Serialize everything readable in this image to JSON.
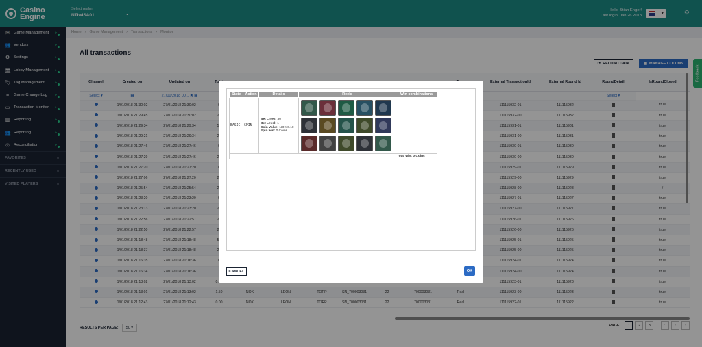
{
  "topbar": {
    "logo_line1": "Casino",
    "logo_line2": "Engine",
    "operator_label": "Select realm",
    "operator_value": "NTIwISA01",
    "hello": "Hello, Stian Enger!",
    "last_login": "Last login: Jan 26 2018"
  },
  "sidebar": {
    "items": [
      {
        "label": "Game Management",
        "icon": "gamepad-icon"
      },
      {
        "label": "Vendors",
        "icon": "users-icon"
      },
      {
        "label": "Settings",
        "icon": "gear-icon"
      },
      {
        "label": "Lobby Management",
        "icon": "lobby-icon"
      },
      {
        "label": "Tag Management",
        "icon": "tag-icon"
      },
      {
        "label": "Game Change Log",
        "icon": "list-icon"
      },
      {
        "label": "Transaction Monitor",
        "icon": "monitor-icon"
      },
      {
        "label": "Reporting",
        "icon": "chart-icon"
      },
      {
        "label": "Reporting",
        "icon": "users-icon"
      },
      {
        "label": "Reconciliation",
        "icon": "balance-icon"
      }
    ],
    "sections": [
      "FAVORITES",
      "RECENTLY USED",
      "VISITED PLAYERS"
    ]
  },
  "breadcrumb": [
    "Home",
    "Game Management",
    "Transactions",
    "Monitor"
  ],
  "page_title": "All transactions",
  "buttons": {
    "reload": "RELOAD DATA",
    "manage": "MANAGE COLUMN"
  },
  "table": {
    "headers": [
      "Channel",
      "Created on",
      "Updated on",
      "Total",
      "",
      "",
      "",
      "",
      "",
      "",
      "Type",
      "External TransactionId",
      "External Round Id",
      "RoundDetail",
      "IsRoundClosed"
    ],
    "filter": {
      "channel": "Select",
      "updated": "27/01/2018 00...",
      "closed": "Select"
    },
    "rows": [
      [
        "1/01/2018 21:30:02",
        "27/01/2018 21:30:02",
        "0",
        "",
        "",
        "",
        "",
        "",
        "",
        "Real",
        "111115932-01",
        "111115932",
        "true"
      ],
      [
        "1/01/2018 21:29:45",
        "27/01/2018 21:30:02",
        "25",
        "",
        "",
        "",
        "",
        "",
        "",
        "Real",
        "111115932-00",
        "111115932",
        "true"
      ],
      [
        "1/01/2018 21:29:34",
        "27/01/2018 21:29:34",
        "50",
        "",
        "",
        "",
        "",
        "",
        "",
        "Real",
        "111115931-01",
        "111115931",
        "true"
      ],
      [
        "1/01/2018 21:29:21",
        "27/01/2018 21:29:34",
        "25",
        "",
        "",
        "",
        "",
        "",
        "",
        "Real",
        "111115931-00",
        "111115931",
        "true"
      ],
      [
        "1/01/2018 21:27:46",
        "27/01/2018 21:27:46",
        "0",
        "",
        "",
        "",
        "",
        "",
        "",
        "Real",
        "111115930-01",
        "111115930",
        "true"
      ],
      [
        "1/01/2018 21:27:29",
        "27/01/2018 21:27:46",
        "25",
        "",
        "",
        "",
        "",
        "",
        "",
        "Real",
        "111115930-00",
        "111115930",
        "true"
      ],
      [
        "1/01/2018 21:27:20",
        "27/01/2018 21:27:20",
        "0",
        "",
        "",
        "",
        "",
        "",
        "",
        "Real",
        "111115929-01",
        "111115929",
        "true"
      ],
      [
        "1/01/2018 21:27:06",
        "27/01/2018 21:27:20",
        "25",
        "",
        "",
        "",
        "",
        "",
        "",
        "Real",
        "111115929-00",
        "111115929",
        "true"
      ],
      [
        "1/01/2018 21:25:54",
        "27/01/2018 21:25:54",
        "25",
        "",
        "",
        "",
        "",
        "",
        "",
        "Real",
        "111115928-00",
        "111115928",
        "-/-"
      ],
      [
        "1/01/2018 21:23:20",
        "27/01/2018 21:23:20",
        "0",
        "",
        "",
        "",
        "",
        "",
        "",
        "Real",
        "111115927-01",
        "111115927",
        "true"
      ],
      [
        "1/01/2018 21:23:13",
        "27/01/2018 21:23:20",
        "20",
        "",
        "",
        "",
        "",
        "",
        "",
        "Real",
        "111115927-00",
        "111115927",
        "true"
      ],
      [
        "1/01/2018 21:22:56",
        "27/01/2018 21:22:57",
        "20",
        "",
        "",
        "",
        "",
        "",
        "",
        "Real",
        "111115926-01",
        "111115926",
        "true"
      ],
      [
        "1/01/2018 21:22:50",
        "27/01/2018 21:22:57",
        "20",
        "",
        "",
        "",
        "",
        "",
        "",
        "Real",
        "111115926-00",
        "111115926",
        "true"
      ],
      [
        "1/01/2018 21:18:48",
        "27/01/2018 21:18:48",
        "50",
        "",
        "",
        "",
        "",
        "",
        "",
        "Real",
        "111115925-01",
        "111115925",
        "true"
      ],
      [
        "1/01/2018 21:18:37",
        "27/01/2018 21:18:48",
        "25",
        "",
        "",
        "",
        "",
        "",
        "",
        "Real",
        "111115925-00",
        "111115925",
        "true"
      ],
      [
        "1/01/2018 21:16:35",
        "27/01/2018 21:16:36",
        "0",
        "",
        "",
        "",
        "",
        "",
        "",
        "Real",
        "111115924-01",
        "111115924",
        "true"
      ],
      [
        "1/01/2018 21:16:34",
        "27/01/2018 21:16:36",
        "1",
        "",
        "",
        "",
        "",
        "",
        "",
        "Real",
        "111115924-00",
        "111115924",
        "true"
      ],
      [
        "1/01/2018 21:13:02",
        "27/01/2018 21:13:02",
        "0.00",
        "NOK",
        "LEON",
        "TORP",
        "SN_700003031",
        "22",
        "700003031",
        "Real",
        "111115923-01",
        "111115923",
        "true"
      ],
      [
        "1/01/2018 21:13:01",
        "27/01/2018 21:13:02",
        "1.50",
        "NOK",
        "LEON",
        "TORP",
        "SN_700003031",
        "22",
        "700003031",
        "Real",
        "111115923-00",
        "111115923",
        "true"
      ],
      [
        "1/01/2018 21:12:43",
        "27/01/2018 21:12:43",
        "0.00",
        "NOK",
        "LEON",
        "TORP",
        "SN_700003031",
        "22",
        "700003031",
        "Real",
        "111115922-01",
        "111115922",
        "true"
      ]
    ]
  },
  "footer": {
    "rpp_label": "RESULTS PER PAGE:",
    "rpp_value": "50",
    "page_label": "PAGE:",
    "pages": [
      "1",
      "2",
      "3",
      "...",
      "71"
    ]
  },
  "feedback": "Feedback",
  "modal": {
    "headers": [
      "State",
      "Action",
      "Details",
      "Reels",
      "Win combinations"
    ],
    "state": "BASIC",
    "action": "SPIN",
    "details": [
      {
        "k": "Bet Lines:",
        "v": "30"
      },
      {
        "k": "Bet Level:",
        "v": "1"
      },
      {
        "k": "Coin Value:",
        "v": "NOK 0.10"
      },
      {
        "k": "Spin win:",
        "v": "0 Coins"
      }
    ],
    "reels": [
      0,
      1,
      2,
      3,
      4,
      5,
      6,
      7,
      8,
      9,
      10,
      11,
      8,
      5,
      0
    ],
    "total_win": "Total win: 0 Coins",
    "cancel": "CANCEL",
    "ok": "OK"
  }
}
